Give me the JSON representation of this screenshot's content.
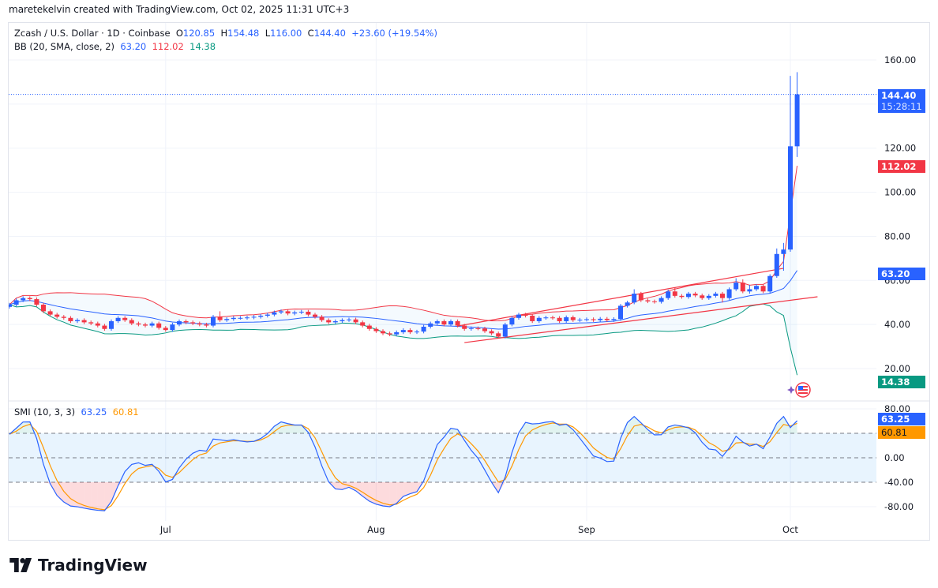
{
  "credit": "maretekelvin created with TradingView.com, Oct 02, 2025 11:31 UTC+3",
  "legend": {
    "symbol": "Zcash / U.S. Dollar · 1D · Coinbase",
    "o_label": "O",
    "o": "120.85",
    "h_label": "H",
    "h": "154.48",
    "l_label": "L",
    "l": "116.00",
    "c_label": "C",
    "c": "144.40",
    "change": "+23.60 (+19.54%)",
    "bb_label": "BB (20, SMA, close, 2)",
    "bb_basis": "63.20",
    "bb_upper": "112.02",
    "bb_lower": "14.38"
  },
  "smi_legend": {
    "label": "SMI (10, 3, 3)",
    "smi": "63.25",
    "signal": "60.81"
  },
  "price_tags": {
    "last": "144.40",
    "countdown": "15:28:11",
    "bb_upper": "112.02",
    "bb_basis": "63.20",
    "bb_lower": "14.38",
    "smi": "63.25",
    "signal": "60.81"
  },
  "footer": {
    "brand": "TradingView"
  },
  "colors": {
    "up": "#2962ff",
    "down": "#f23645",
    "bb_upper": "#f23645",
    "bb_basis": "#2962ff",
    "bb_lower": "#089981",
    "smi": "#2962ff",
    "signal": "#ff9800",
    "trendline": "#f23645"
  },
  "chart_data": [
    {
      "type": "candlestick",
      "symbol": "Zcash / U.S. Dollar",
      "interval": "1D",
      "ylim": [
        10,
        165
      ],
      "y_ticks": [
        "160.00",
        "140.00",
        "120.00",
        "100.00",
        "80.00",
        "60.00",
        "40.00",
        "20.00"
      ],
      "x_ticks": [
        {
          "label": "Jul",
          "date": "2025-07-01"
        },
        {
          "label": "Aug",
          "date": "2025-08-01"
        },
        {
          "label": "Sep",
          "date": "2025-09-01"
        },
        {
          "label": "Oct",
          "date": "2025-10-01"
        }
      ],
      "grid": true,
      "last_price": 144.4,
      "dates": [
        "2025-06-08",
        "2025-06-09",
        "2025-06-10",
        "2025-06-11",
        "2025-06-12",
        "2025-06-13",
        "2025-06-14",
        "2025-06-15",
        "2025-06-16",
        "2025-06-17",
        "2025-06-18",
        "2025-06-19",
        "2025-06-20",
        "2025-06-21",
        "2025-06-22",
        "2025-06-23",
        "2025-06-24",
        "2025-06-25",
        "2025-06-26",
        "2025-06-27",
        "2025-06-28",
        "2025-06-29",
        "2025-06-30",
        "2025-07-01",
        "2025-07-02",
        "2025-07-03",
        "2025-07-04",
        "2025-07-05",
        "2025-07-06",
        "2025-07-07",
        "2025-07-08",
        "2025-07-09",
        "2025-07-10",
        "2025-07-11",
        "2025-07-12",
        "2025-07-13",
        "2025-07-14",
        "2025-07-15",
        "2025-07-16",
        "2025-07-17",
        "2025-07-18",
        "2025-07-19",
        "2025-07-20",
        "2025-07-21",
        "2025-07-22",
        "2025-07-23",
        "2025-07-24",
        "2025-07-25",
        "2025-07-26",
        "2025-07-27",
        "2025-07-28",
        "2025-07-29",
        "2025-07-30",
        "2025-07-31",
        "2025-08-01",
        "2025-08-02",
        "2025-08-03",
        "2025-08-04",
        "2025-08-05",
        "2025-08-06",
        "2025-08-07",
        "2025-08-08",
        "2025-08-09",
        "2025-08-10",
        "2025-08-11",
        "2025-08-12",
        "2025-08-13",
        "2025-08-14",
        "2025-08-15",
        "2025-08-16",
        "2025-08-17",
        "2025-08-18",
        "2025-08-19",
        "2025-08-20",
        "2025-08-21",
        "2025-08-22",
        "2025-08-23",
        "2025-08-24",
        "2025-08-25",
        "2025-08-26",
        "2025-08-27",
        "2025-08-28",
        "2025-08-29",
        "2025-08-30",
        "2025-08-31",
        "2025-09-01",
        "2025-09-02",
        "2025-09-03",
        "2025-09-04",
        "2025-09-05",
        "2025-09-06",
        "2025-09-07",
        "2025-09-08",
        "2025-09-09",
        "2025-09-10",
        "2025-09-11",
        "2025-09-12",
        "2025-09-13",
        "2025-09-14",
        "2025-09-15",
        "2025-09-16",
        "2025-09-17",
        "2025-09-18",
        "2025-09-19",
        "2025-09-20",
        "2025-09-21",
        "2025-09-22",
        "2025-09-23",
        "2025-09-24",
        "2025-09-25",
        "2025-09-26",
        "2025-09-27",
        "2025-09-28",
        "2025-09-29",
        "2025-09-30",
        "2025-10-01",
        "2025-10-02"
      ],
      "open": [
        48,
        49,
        51,
        52,
        51.5,
        49,
        46,
        44.5,
        43.5,
        43,
        41.5,
        42,
        41,
        40.5,
        39.5,
        38,
        41.5,
        43,
        42,
        40.5,
        40,
        39.5,
        40.5,
        38.5,
        37.5,
        40,
        41.5,
        41,
        40.5,
        40,
        39.5,
        43.5,
        42,
        42.5,
        43,
        43,
        43.2,
        43.5,
        44,
        44.5,
        45.5,
        46,
        45,
        45.5,
        45.8,
        44.5,
        43.5,
        42,
        41,
        41.5,
        42,
        42.3,
        41,
        39.5,
        38,
        37,
        36,
        35.5,
        36.5,
        37.5,
        36.5,
        36.8,
        39,
        40.5,
        41.5,
        40,
        41.5,
        39.5,
        38,
        38.3,
        38.2,
        37,
        36,
        34.5,
        40,
        43,
        44.5,
        44,
        41.5,
        43,
        43.2,
        43,
        41.5,
        43.3,
        42,
        42.2,
        42.4,
        42,
        42.6,
        42,
        42.5,
        48.5,
        50,
        54,
        51,
        50.5,
        50.3,
        52,
        55,
        53,
        52.5,
        54,
        53.2,
        52,
        53,
        54,
        52,
        56,
        59,
        55,
        56,
        57.5,
        55,
        62,
        72,
        74,
        120.85
      ],
      "high": [
        49.8,
        51.8,
        52.8,
        52.8,
        52.3,
        49.8,
        46.8,
        45.3,
        44.3,
        43.8,
        42.8,
        42.8,
        41.8,
        41.3,
        40.3,
        42.3,
        43.8,
        43.8,
        42.8,
        41.3,
        40.8,
        41.3,
        41.3,
        39.3,
        40.8,
        42.3,
        42.3,
        41.8,
        41.3,
        40.8,
        44.3,
        46,
        43.3,
        43.8,
        43.8,
        44,
        44.3,
        44.8,
        45.3,
        46.3,
        46.8,
        46.8,
        46.3,
        46.6,
        46.6,
        45.3,
        44.3,
        42.8,
        42.3,
        42.8,
        43.1,
        43.1,
        41.8,
        40.3,
        38.8,
        37.8,
        36.8,
        37.3,
        38.3,
        38.3,
        37.6,
        39.8,
        41.3,
        42.3,
        42.3,
        42.3,
        42.3,
        40.3,
        39.1,
        39.1,
        39,
        37.8,
        36.8,
        40.8,
        43.8,
        45.3,
        45.3,
        44.8,
        43.8,
        44,
        44,
        43.8,
        44.1,
        44.1,
        43,
        43.2,
        43.2,
        43.4,
        43.4,
        43.3,
        49.3,
        50.8,
        56,
        54.8,
        51.8,
        51.3,
        52.8,
        55.8,
        56.8,
        53.8,
        54.8,
        54.8,
        54,
        53.8,
        54.8,
        54.8,
        56.8,
        61,
        60.5,
        58,
        58.3,
        58.3,
        62.8,
        74.5,
        77,
        152.8,
        154.48
      ],
      "low": [
        47.2,
        48.2,
        50.2,
        50.7,
        48.2,
        45.2,
        43.7,
        42.7,
        42.2,
        40.7,
        40.7,
        40.2,
        39.7,
        38.7,
        37.2,
        37.2,
        40.7,
        41.2,
        39.7,
        39.2,
        38.7,
        38.7,
        37.7,
        36.7,
        36.7,
        39.2,
        40.2,
        39.7,
        39.2,
        38.7,
        38.7,
        41.2,
        41.2,
        41.7,
        42.2,
        42.2,
        42.4,
        42.7,
        43.2,
        43.7,
        44.7,
        44.2,
        44.2,
        44.7,
        43.7,
        42.7,
        41.2,
        40.2,
        40.2,
        40.7,
        41.2,
        40.2,
        38.7,
        37.2,
        36.2,
        35.2,
        34.7,
        34.7,
        35.7,
        35.7,
        35.7,
        36,
        38.2,
        39.7,
        39.2,
        39.2,
        38.7,
        37.2,
        37.2,
        37.4,
        36.2,
        35.2,
        33.7,
        33.7,
        39.2,
        42.2,
        43.2,
        40.7,
        40.7,
        42.2,
        42.2,
        40.7,
        40.7,
        41.2,
        41.2,
        41.4,
        41.2,
        41.2,
        41.2,
        41.2,
        41.7,
        47.7,
        49.2,
        50.2,
        49.7,
        49.5,
        49.5,
        51.2,
        52.2,
        51.7,
        51.7,
        52.4,
        51.2,
        51.2,
        52.2,
        50,
        51.2,
        55.2,
        54.2,
        54,
        55.2,
        54.2,
        54.2,
        61.2,
        64.4,
        73,
        116
      ],
      "close": [
        49,
        51,
        52,
        51.5,
        49,
        46,
        44.5,
        43.5,
        43,
        41.5,
        42,
        41,
        40.5,
        39.5,
        38,
        41.5,
        43,
        42,
        40.5,
        40,
        39.5,
        40.5,
        38.5,
        37.5,
        40,
        41.5,
        41,
        40.5,
        40,
        39.5,
        43.5,
        42,
        42.5,
        43,
        43,
        43.2,
        43.5,
        44,
        44.5,
        45.5,
        46,
        45,
        45.5,
        45.8,
        44.5,
        43.5,
        42,
        41,
        41.5,
        42,
        42.3,
        41,
        39.5,
        38,
        37,
        36,
        35.5,
        36.5,
        37.5,
        36.5,
        36.8,
        39,
        40.5,
        41.5,
        40,
        41.5,
        39.5,
        38,
        38.3,
        38.2,
        37,
        36,
        34.5,
        40,
        43,
        44.5,
        44,
        41.5,
        43,
        43.2,
        43,
        41.5,
        43.3,
        42,
        42.2,
        42.4,
        42,
        42.6,
        42,
        42.5,
        48.5,
        50,
        54,
        51,
        50.5,
        50.3,
        52,
        55,
        53,
        52.5,
        54,
        53.2,
        52,
        53,
        54,
        52,
        56,
        59,
        55,
        56,
        57.5,
        55,
        62,
        72,
        74,
        120.85,
        144.4
      ],
      "indicators": {
        "bb": {
          "length": 20,
          "source": "close",
          "mult": 2,
          "last": {
            "basis": 63.2,
            "upper": 112.02,
            "lower": 14.38
          }
        }
      },
      "trendlines": [
        {
          "from": {
            "date": "2025-08-13",
            "price": 39.3
          },
          "to": {
            "date": "2025-09-30",
            "price": 65.5
          }
        },
        {
          "from": {
            "date": "2025-08-14",
            "price": 31.8
          },
          "to": {
            "date": "2025-10-05",
            "price": 52.6
          }
        }
      ]
    },
    {
      "type": "line",
      "title": "SMI (10, 3, 3)",
      "ylim": [
        -90,
        90
      ],
      "y_ticks": [
        "80.00",
        "40.00",
        "0.00",
        "-40.00",
        "-80.00"
      ],
      "levels": [
        40,
        0,
        -40
      ],
      "last": {
        "smi": 63.25,
        "signal": 60.81
      }
    }
  ]
}
